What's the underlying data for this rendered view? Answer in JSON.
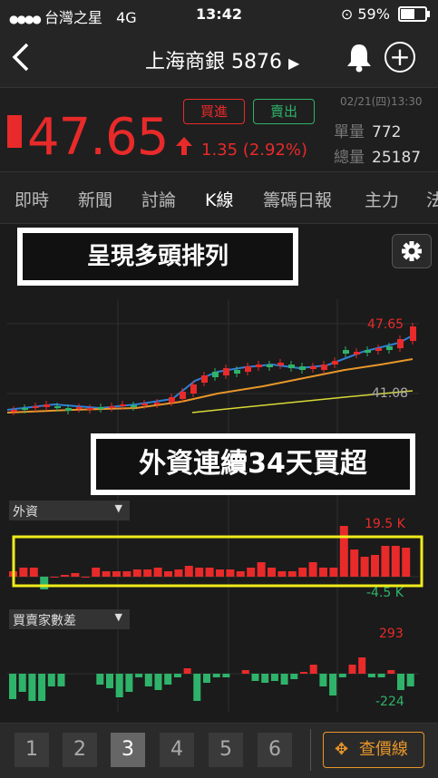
{
  "status": {
    "carrier": "台灣之星",
    "network": "4G",
    "time": "13:42",
    "battery": "59%"
  },
  "nav": {
    "stock_name": "上海商銀",
    "stock_code": "5876",
    "play_icon": "▶"
  },
  "quote": {
    "price": "47.65",
    "change": "1.35 (2.92%)",
    "buy_label": "買進",
    "sell_label": "賣出",
    "datetime": "02/21(四)13:30",
    "unit_vol_label": "單量",
    "unit_vol": "772",
    "total_vol_label": "總量",
    "total_vol": "25187",
    "color_up": "#e82a2a",
    "color_down": "#2fb36a"
  },
  "tabs": [
    "即時",
    "新聞",
    "討論",
    "K線",
    "籌碼日報",
    "主力",
    "法"
  ],
  "active_tab": "K線",
  "banners": {
    "top": "呈現多頭排列",
    "middle": "外資連續34天買超"
  },
  "price_chart": {
    "high_label": "47.65",
    "low_label": "41.08"
  },
  "foreign": {
    "selector": "外資",
    "max_label": "19.5 K",
    "min_label": "-4.5 K"
  },
  "brokers": {
    "selector": "買賣家數差",
    "max_label": "293",
    "min_label": "-224"
  },
  "periods": [
    "1",
    "2",
    "3",
    "4",
    "5",
    "6"
  ],
  "active_period": "3",
  "price_line_label": "查價線"
}
